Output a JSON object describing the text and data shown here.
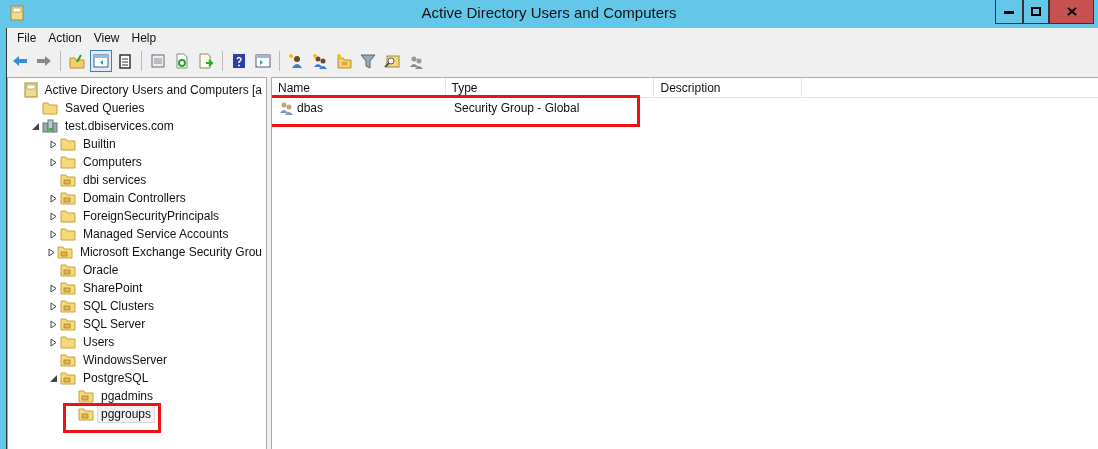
{
  "window": {
    "title": "Active Directory Users and Computers"
  },
  "menu": [
    {
      "label": "File"
    },
    {
      "label": "Action"
    },
    {
      "label": "View"
    },
    {
      "label": "Help"
    }
  ],
  "toolbar": {
    "console_tree_pressed": true
  },
  "tree": [
    {
      "label": "Active Directory Users and Computers [a",
      "children": [
        {
          "label": "Saved Queries",
          "kind": "folder"
        },
        {
          "label": "test.dbiservices.com",
          "kind": "domain",
          "expanded": true,
          "children": [
            {
              "label": "Builtin",
              "kind": "folder",
              "expandable": true
            },
            {
              "label": "Computers",
              "kind": "folder",
              "expandable": true
            },
            {
              "label": "dbi services",
              "kind": "ou"
            },
            {
              "label": "Domain Controllers",
              "kind": "ou",
              "expandable": true
            },
            {
              "label": "ForeignSecurityPrincipals",
              "kind": "folder",
              "expandable": true
            },
            {
              "label": "Managed Service Accounts",
              "kind": "folder",
              "expandable": true
            },
            {
              "label": "Microsoft Exchange Security Grou",
              "kind": "ou",
              "expandable": true
            },
            {
              "label": "Oracle",
              "kind": "ou"
            },
            {
              "label": "SharePoint",
              "kind": "ou",
              "expandable": true
            },
            {
              "label": "SQL Clusters",
              "kind": "ou",
              "expandable": true
            },
            {
              "label": "SQL Server",
              "kind": "ou",
              "expandable": true
            },
            {
              "label": "Users",
              "kind": "folder",
              "expandable": true
            },
            {
              "label": "WindowsServer",
              "kind": "ou"
            },
            {
              "label": "PostgreSQL",
              "kind": "ou",
              "expanded": true,
              "children": [
                {
                  "label": "pgadmins",
                  "kind": "ou"
                },
                {
                  "label": "pggroups",
                  "kind": "ou",
                  "selected": true,
                  "annotated": true
                }
              ]
            }
          ]
        }
      ]
    }
  ],
  "list": {
    "columns": [
      {
        "label": "Name"
      },
      {
        "label": "Type"
      },
      {
        "label": "Description"
      }
    ],
    "rows": [
      {
        "name": "dbas",
        "type": "Security Group - Global",
        "annotated": true
      }
    ]
  }
}
